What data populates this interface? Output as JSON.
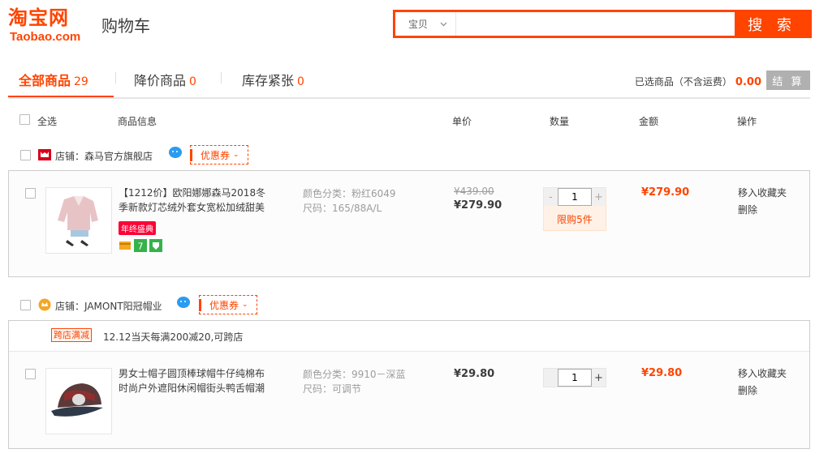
{
  "header": {
    "logo_cn": "淘宝网",
    "logo_en": "Taobao.com",
    "title": "购物车"
  },
  "search": {
    "category": "宝贝",
    "placeholder": "",
    "button": "搜 索"
  },
  "tabs": [
    {
      "label": "全部商品",
      "count": "29"
    },
    {
      "label": "降价商品",
      "count": "0"
    },
    {
      "label": "库存紧张",
      "count": "0"
    }
  ],
  "summary": {
    "label": "已选商品（不含运费）",
    "total": "0.00",
    "checkout": "结 算"
  },
  "columns": {
    "select_all": "全选",
    "info": "商品信息",
    "price": "单价",
    "qty": "数量",
    "amount": "金额",
    "ops": "操作"
  },
  "shops": [
    {
      "label": "店铺：",
      "name": "森马官方旗舰店",
      "coupon": "优惠券",
      "items": [
        {
          "title": "【1212价】欧阳娜娜森马2018冬季新款灯芯绒外套女宽松加绒甜美",
          "badge": "年终盛典",
          "prop_color": "颜色分类：粉红6049",
          "prop_size": "尺码：165/88A/L",
          "price_old": "¥439.00",
          "price_now": "¥279.90",
          "qty": "1",
          "limit": "限购5件",
          "amount": "¥279.90",
          "op_fav": "移入收藏夹",
          "op_del": "删除"
        }
      ]
    },
    {
      "label": "店铺：",
      "name": "JAMONT阳冠帽业",
      "coupon": "优惠券",
      "promo_tag": "跨店满减",
      "promo_text": "12.12当天每满200减20,可跨店",
      "items": [
        {
          "title": "男女士帽子圆顶棒球帽牛仔纯棉布时尚户外遮阳休闲帽街头鸭舌帽潮",
          "prop_color": "颜色分类：9910－深蓝",
          "prop_size": "尺码：可调节",
          "price_now": "¥29.80",
          "qty": "1",
          "amount": "¥29.80",
          "op_fav": "移入收藏夹",
          "op_del": "删除"
        }
      ]
    }
  ],
  "colors": {
    "accent": "#ff4400"
  }
}
